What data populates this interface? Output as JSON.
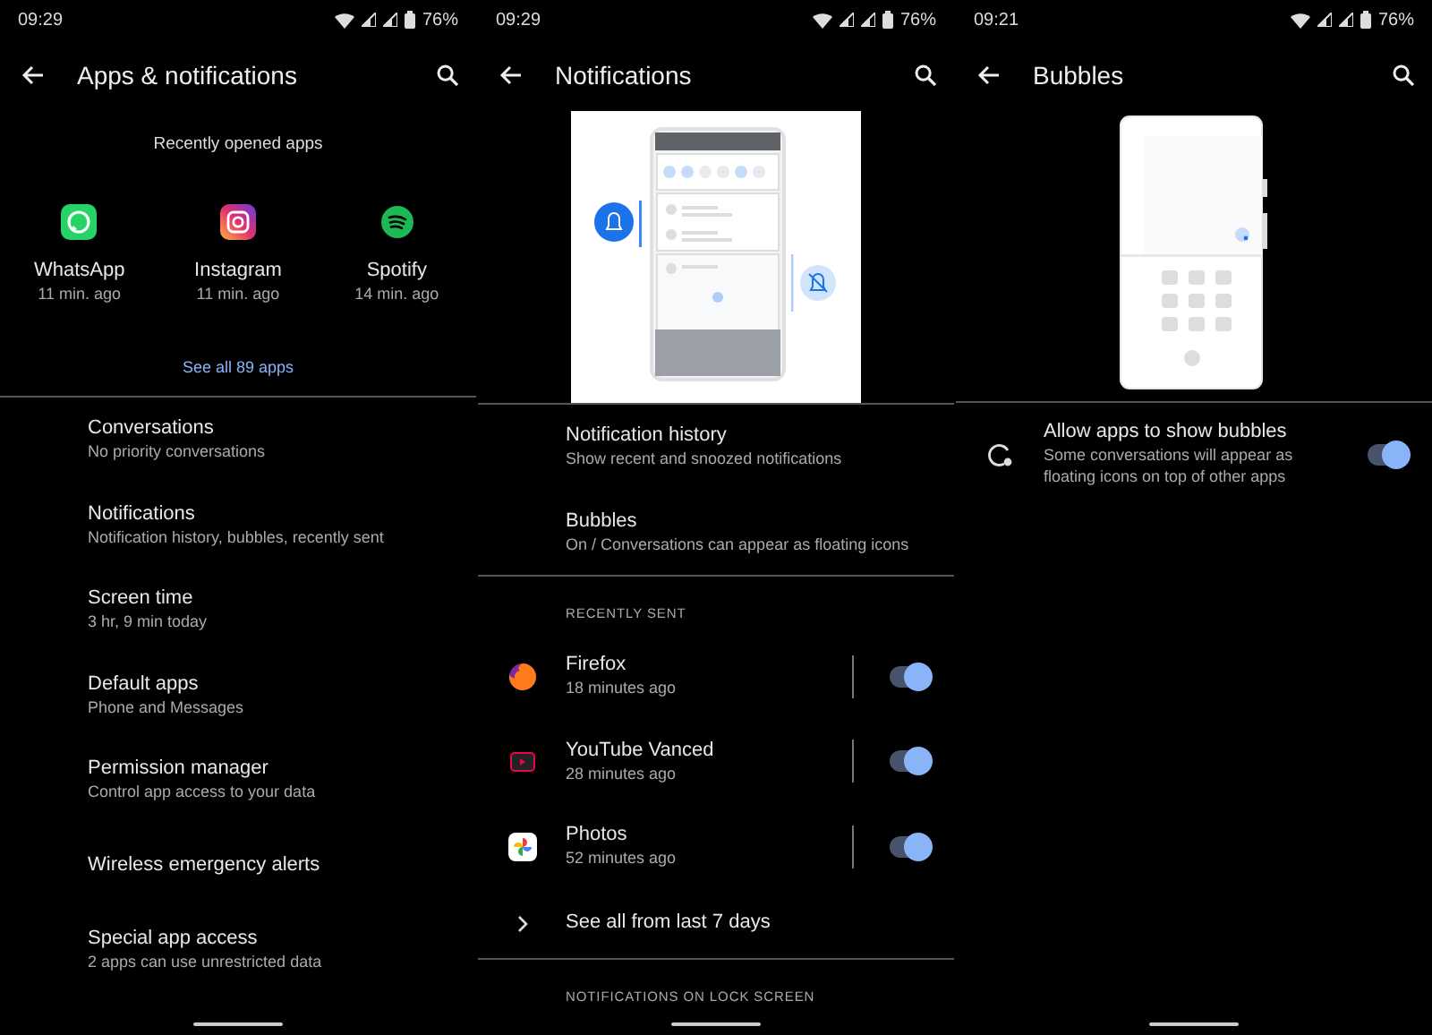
{
  "screens": [
    {
      "status": {
        "time": "09:29",
        "battery": "76%"
      },
      "title": "Apps & notifications",
      "blocks": [
        {
          "kind": "recent_apps",
          "heading": "Recently opened apps",
          "apps": [
            {
              "kind": "chat",
              "name": "WhatsApp",
              "time": "11 min. ago"
            },
            {
              "kind": "camera",
              "name": "Instagram",
              "time": "11 min. ago"
            },
            {
              "kind": "music",
              "name": "Spotify",
              "time": "14 min. ago"
            }
          ],
          "link": "See all 89 apps"
        },
        {
          "kind": "divider"
        },
        {
          "kind": "setting",
          "title": "Conversations",
          "subtitle": "No priority conversations"
        },
        {
          "kind": "setting",
          "title": "Notifications",
          "subtitle": "Notification history, bubbles, recently sent"
        },
        {
          "kind": "setting",
          "title": "Screen time",
          "subtitle": "3 hr, 9 min today"
        },
        {
          "kind": "setting",
          "title": "Default apps",
          "subtitle": "Phone and Messages"
        },
        {
          "kind": "setting",
          "title": "Permission manager",
          "subtitle": "Control app access to your data"
        },
        {
          "kind": "setting",
          "title": "Wireless emergency alerts"
        },
        {
          "kind": "setting",
          "title": "Special app access",
          "subtitle": "2 apps can use unrestricted data"
        }
      ]
    },
    {
      "status": {
        "time": "09:29",
        "battery": "76%"
      },
      "title": "Notifications",
      "blocks": [
        {
          "kind": "illustration"
        },
        {
          "kind": "divider"
        },
        {
          "kind": "setting",
          "title": "Notification history",
          "subtitle": "Show recent and snoozed notifications"
        },
        {
          "kind": "setting",
          "title": "Bubbles",
          "subtitle": "On / Conversations can appear as floating icons"
        },
        {
          "kind": "divider"
        },
        {
          "kind": "header",
          "text": "RECENTLY SENT"
        },
        {
          "kind": "app_toggle",
          "title": "Firefox",
          "subtitle": "18 minutes ago",
          "on": true
        },
        {
          "kind": "app_toggle",
          "title": "YouTube Vanced",
          "subtitle": "28 minutes ago",
          "on": true
        },
        {
          "kind": "app_toggle",
          "title": "Photos",
          "subtitle": "52 minutes ago",
          "on": true
        },
        {
          "kind": "link",
          "text": "See all from last 7 days"
        },
        {
          "kind": "divider"
        },
        {
          "kind": "header",
          "text": "NOTIFICATIONS ON LOCK SCREEN"
        }
      ]
    },
    {
      "status": {
        "time": "09:21",
        "battery": "76%"
      },
      "title": "Bubbles",
      "blocks": [
        {
          "kind": "illustration"
        },
        {
          "kind": "divider"
        },
        {
          "kind": "toggle_setting",
          "title": "Allow apps to show bubbles",
          "subtitle": "Some conversations will appear as floating icons on top of other apps",
          "on": true
        }
      ]
    }
  ]
}
